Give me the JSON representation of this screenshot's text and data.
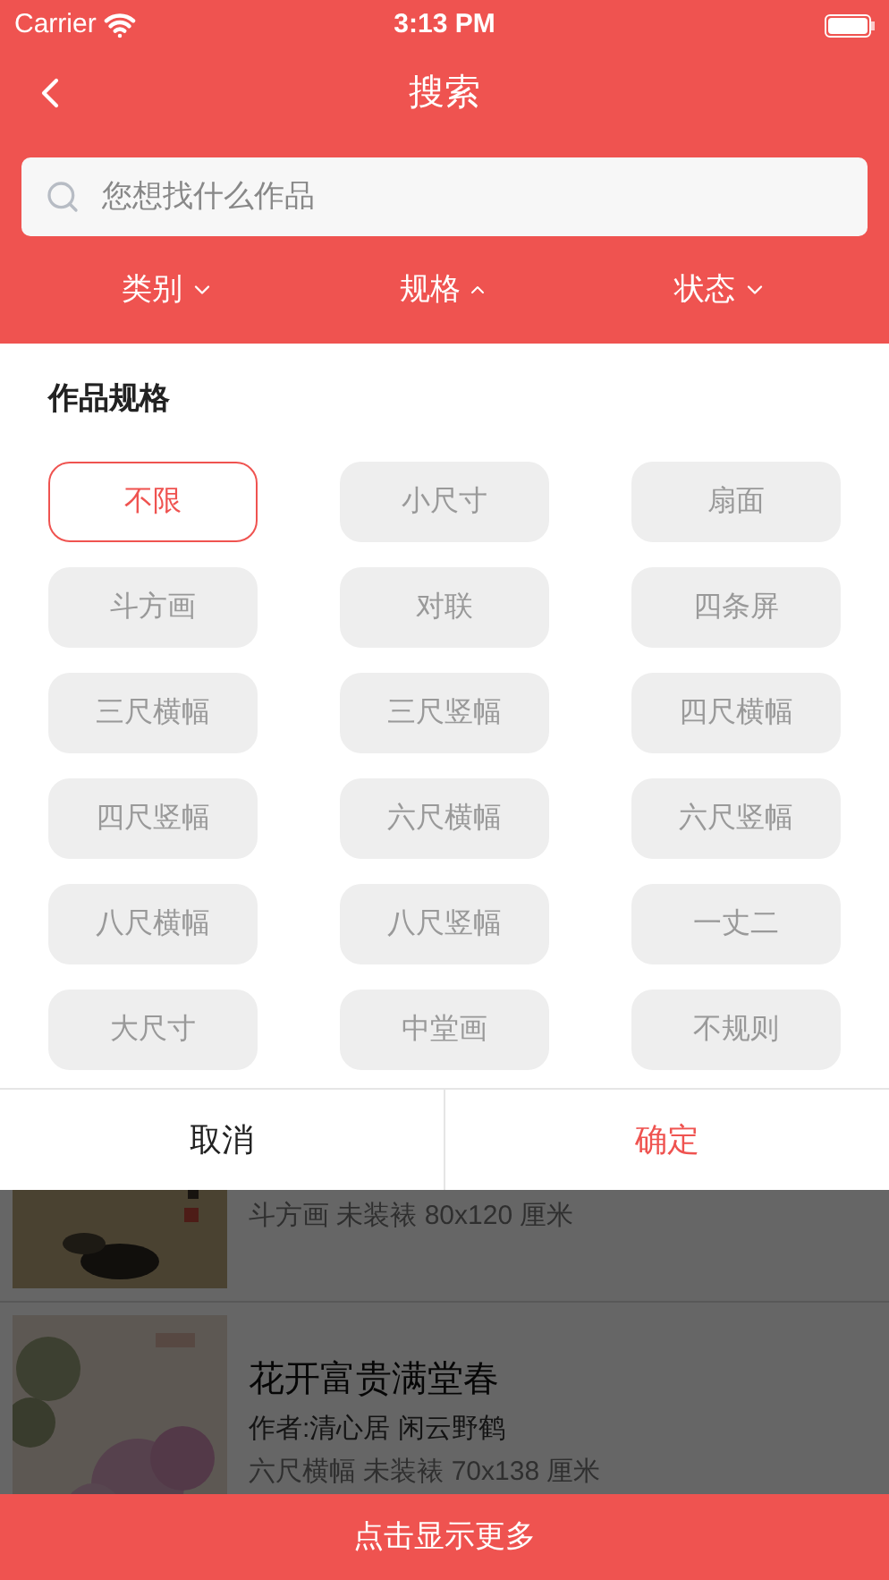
{
  "status_bar": {
    "carrier": "Carrier",
    "time": "3:13 PM"
  },
  "nav": {
    "title": "搜索"
  },
  "search": {
    "placeholder": "您想找什么作品"
  },
  "filters": [
    {
      "label": "类别",
      "expanded": false
    },
    {
      "label": "规格",
      "expanded": true
    },
    {
      "label": "状态",
      "expanded": false
    }
  ],
  "panel": {
    "heading": "作品规格",
    "options": [
      {
        "label": "不限",
        "selected": true
      },
      {
        "label": "小尺寸",
        "selected": false
      },
      {
        "label": "扇面",
        "selected": false
      },
      {
        "label": "斗方画",
        "selected": false
      },
      {
        "label": "对联",
        "selected": false
      },
      {
        "label": "四条屏",
        "selected": false
      },
      {
        "label": "三尺横幅",
        "selected": false
      },
      {
        "label": "三尺竖幅",
        "selected": false
      },
      {
        "label": "四尺横幅",
        "selected": false
      },
      {
        "label": "四尺竖幅",
        "selected": false
      },
      {
        "label": "六尺横幅",
        "selected": false
      },
      {
        "label": "六尺竖幅",
        "selected": false
      },
      {
        "label": "八尺横幅",
        "selected": false
      },
      {
        "label": "八尺竖幅",
        "selected": false
      },
      {
        "label": "一丈二",
        "selected": false
      },
      {
        "label": "大尺寸",
        "selected": false
      },
      {
        "label": "中堂画",
        "selected": false
      },
      {
        "label": "不规则",
        "selected": false
      }
    ],
    "cancel": "取消",
    "confirm": "确定"
  },
  "results": [
    {
      "spec": "斗方画 未装裱 80x120 厘米"
    },
    {
      "title": "花开富贵满堂春",
      "author": "作者:清心居 闲云野鹤",
      "spec": "六尺横幅 未装裱 70x138 厘米"
    }
  ],
  "more_button": "点击显示更多"
}
